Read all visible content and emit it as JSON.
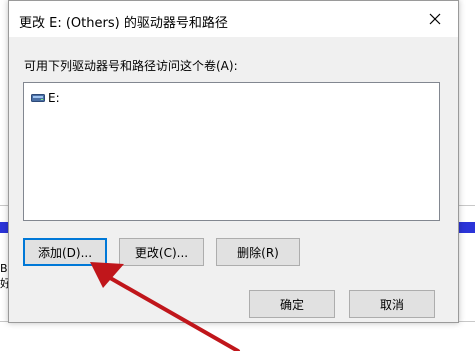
{
  "background": {
    "text_line_1": "B",
    "text_line_2": "好"
  },
  "dialog": {
    "title": "更改 E: (Others) 的驱动器号和路径",
    "prompt": "可用下列驱动器号和路径访问这个卷(A):",
    "list_items": [
      {
        "label": "E:",
        "icon": "drive-icon"
      }
    ],
    "buttons": {
      "add": "添加(D)...",
      "change": "更改(C)...",
      "delete": "删除(R)",
      "ok": "确定",
      "cancel": "取消"
    },
    "close_icon": "close-icon"
  },
  "annotation": {
    "arrow_color": "#c0161b",
    "points_to": "add-button"
  },
  "colors": {
    "focus_border": "#0078d7",
    "dialog_bg": "#f0f0f0",
    "button_bg": "#e1e1e1",
    "background_bar": "#2b34d8"
  }
}
